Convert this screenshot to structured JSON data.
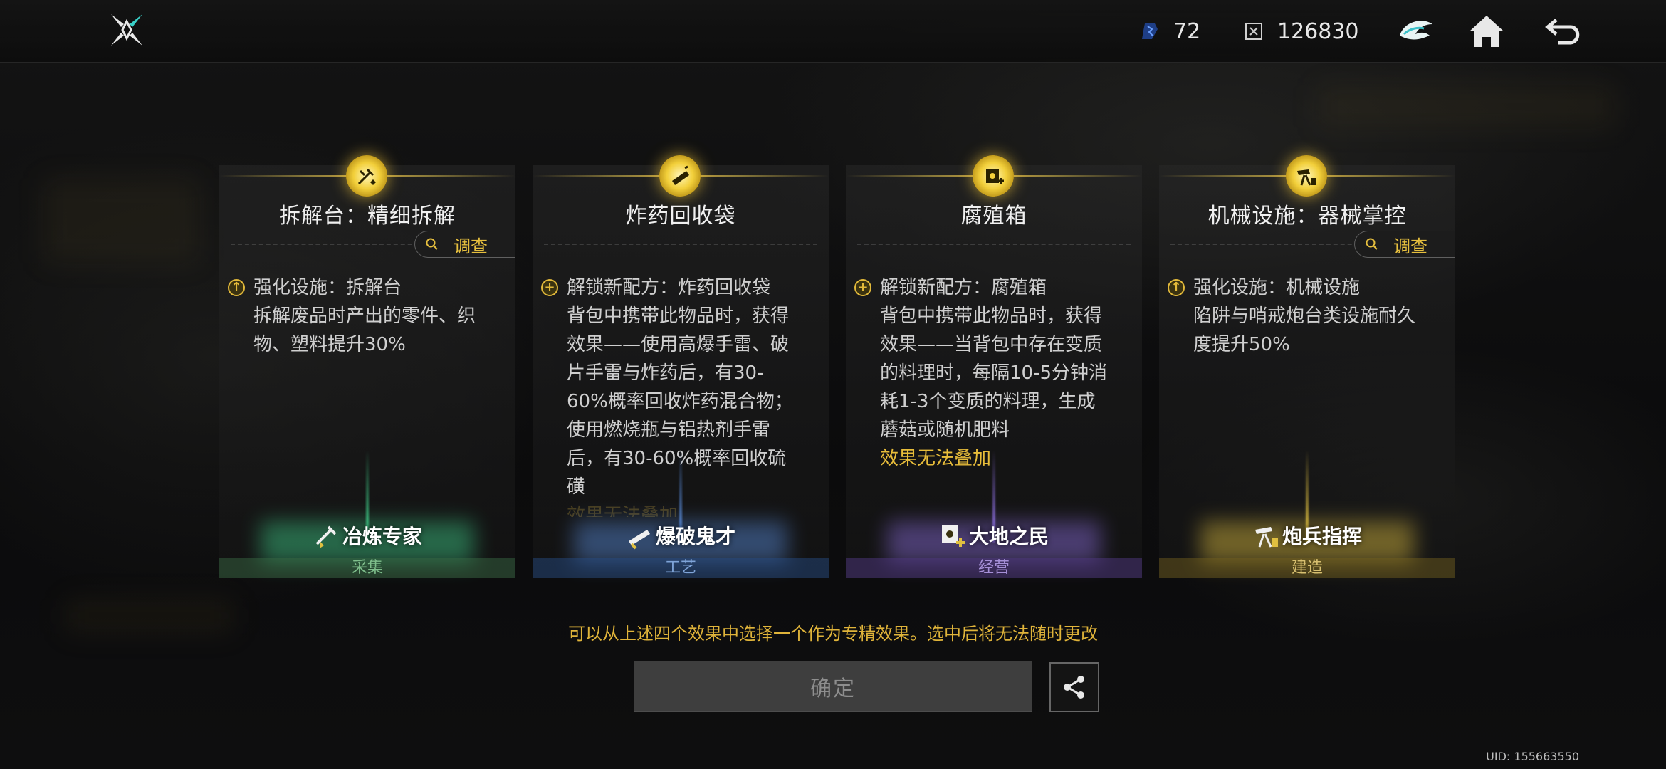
{
  "topbar": {
    "resource1": {
      "icon": "energy-chip-icon",
      "value": "72"
    },
    "resource2": {
      "icon": "currency-icon",
      "value": "126830"
    }
  },
  "cards": [
    {
      "title": "拆解台：精细拆解",
      "has_probe": true,
      "desc_lines": [
        "强化设施：拆解台",
        "拆解废品时产出的零件、织",
        "物、塑料提升30%"
      ],
      "perk": "冶炼专家",
      "category": "采集",
      "accent": "#3fcf8a"
    },
    {
      "title": "炸药回收袋",
      "has_probe": false,
      "desc_lines": [
        "解锁新配方：炸药回收袋",
        "背包中携带此物品时，获得",
        "效果——使用高爆手雷、破",
        "片手雷与炸药后，有30-",
        "60%概率回收炸药混合物；",
        "使用燃烧瓶与铝热剂手雷",
        "后，有30-60%概率回收硫",
        "磺"
      ],
      "faded_line": "效果无法叠加",
      "perk": "爆破鬼才",
      "category": "工艺",
      "accent": "#5b8fe0"
    },
    {
      "title": "腐殖箱",
      "has_probe": false,
      "desc_lines": [
        "解锁新配方：腐殖箱",
        "背包中携带此物品时，获得",
        "效果——当背包中存在变质",
        "的料理时，每隔10-5分钟消",
        "耗1-3个变质的料理，生成",
        "蘑菇或随机肥料"
      ],
      "gold_line": "效果无法叠加",
      "perk": "大地之民",
      "category": "经营",
      "accent": "#8d6fe0"
    },
    {
      "title": "机械设施：器械掌控",
      "has_probe": true,
      "desc_lines": [
        "强化设施：机械设施",
        "陷阱与哨戒炮台类设施耐久",
        "度提升50%"
      ],
      "perk": "炮兵指挥",
      "category": "建造",
      "accent": "#e0c040"
    }
  ],
  "probe_label": "调查",
  "hint": "可以从上述四个效果中选择一个作为专精效果。选中后将无法随时更改",
  "confirm_label": "确定",
  "uid": "UID: 155663550"
}
